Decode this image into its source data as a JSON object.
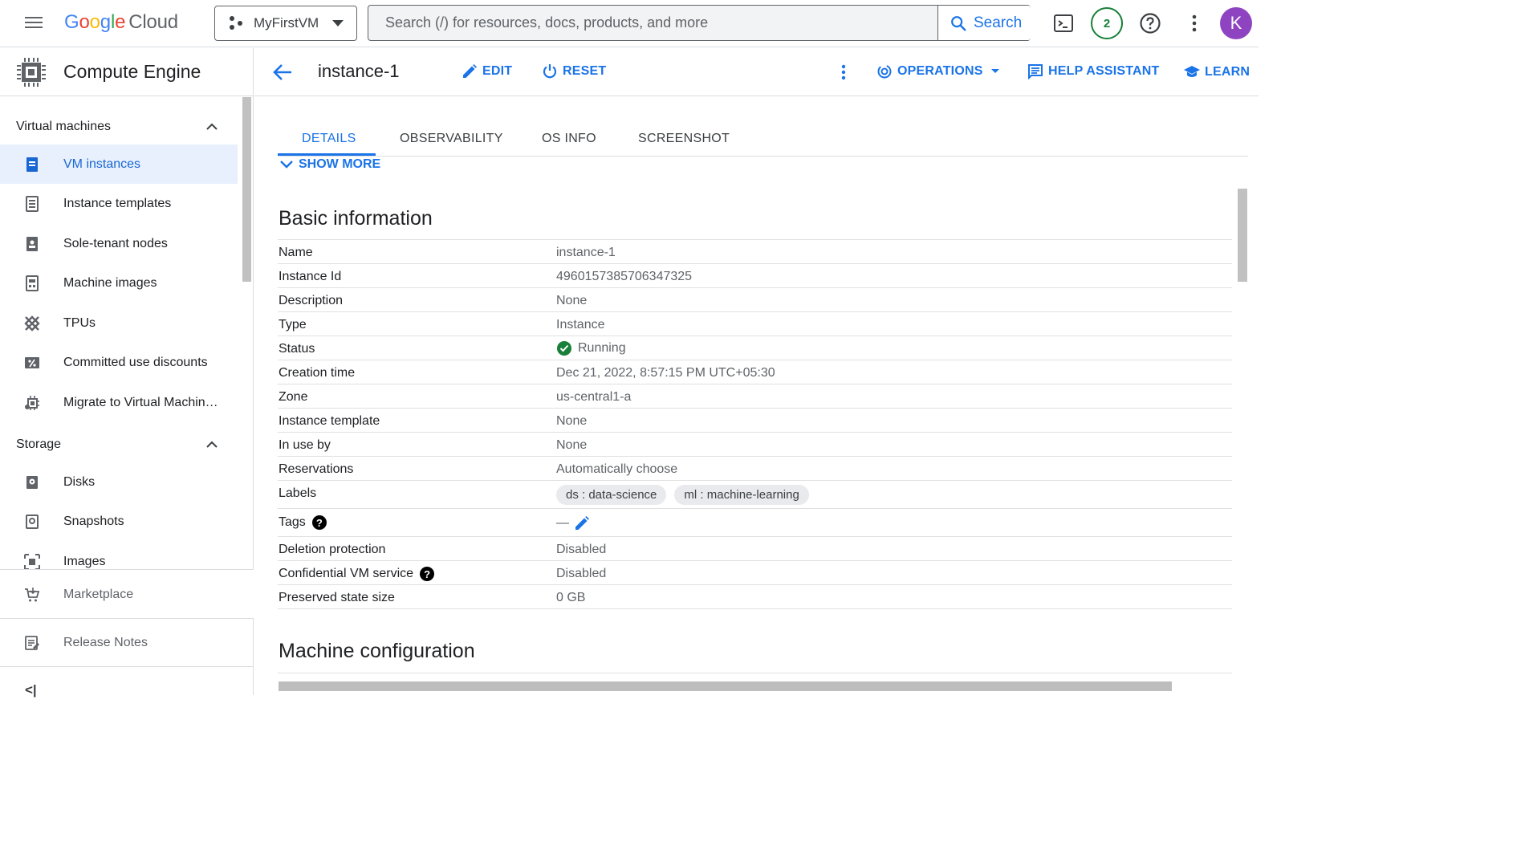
{
  "topbar": {
    "brand_google": [
      "G",
      "o",
      "o",
      "g",
      "l",
      "e"
    ],
    "brand_cloud": "Cloud",
    "project": "MyFirstVM",
    "search_placeholder": "Search (/) for resources, docs, products, and more",
    "search_button": "Search",
    "notification_count": "2",
    "avatar_letter": "K"
  },
  "sidebar": {
    "product_title": "Compute Engine",
    "sections": [
      {
        "label": "Virtual machines"
      },
      {
        "label": "Storage"
      }
    ],
    "vm_items": [
      {
        "label": "VM instances",
        "icon": "vm-instance-icon",
        "active": true
      },
      {
        "label": "Instance templates",
        "icon": "template-icon"
      },
      {
        "label": "Sole-tenant nodes",
        "icon": "node-icon"
      },
      {
        "label": "Machine images",
        "icon": "machine-image-icon"
      },
      {
        "label": "TPUs",
        "icon": "tpu-icon"
      },
      {
        "label": "Committed use discounts",
        "icon": "percent-icon"
      },
      {
        "label": "Migrate to Virtual Machin…",
        "icon": "migrate-icon"
      }
    ],
    "storage_items": [
      {
        "label": "Disks",
        "icon": "disk-icon"
      },
      {
        "label": "Snapshots",
        "icon": "snapshot-icon"
      },
      {
        "label": "Images",
        "icon": "image-icon"
      }
    ],
    "footer_items": [
      {
        "label": "Marketplace",
        "icon": "cart-icon"
      },
      {
        "label": "Release Notes",
        "icon": "notes-icon"
      }
    ],
    "collapse_glyph": "<|"
  },
  "header": {
    "instance_name": "instance-1",
    "edit": "EDIT",
    "reset": "RESET",
    "operations": "OPERATIONS",
    "help_assistant": "HELP ASSISTANT",
    "learn": "LEARN"
  },
  "tabs": [
    "DETAILS",
    "OBSERVABILITY",
    "OS INFO",
    "SCREENSHOT"
  ],
  "show_more": "SHOW MORE",
  "basic_info": {
    "title": "Basic information",
    "rows": [
      {
        "key": "Name",
        "value": "instance-1"
      },
      {
        "key": "Instance Id",
        "value": "4960157385706347325"
      },
      {
        "key": "Description",
        "value": "None"
      },
      {
        "key": "Type",
        "value": "Instance"
      },
      {
        "key": "Status",
        "value": "Running"
      },
      {
        "key": "Creation time",
        "value": "Dec 21, 2022, 8:57:15 PM UTC+05:30"
      },
      {
        "key": "Zone",
        "value": "us-central1-a"
      },
      {
        "key": "Instance template",
        "value": "None"
      },
      {
        "key": "In use by",
        "value": "None"
      },
      {
        "key": "Reservations",
        "value": "Automatically choose"
      },
      {
        "key": "Labels",
        "value": [
          "ds : data-science",
          "ml : machine-learning"
        ]
      },
      {
        "key": "Tags",
        "value": "—"
      },
      {
        "key": "Deletion protection",
        "value": "Disabled"
      },
      {
        "key": "Confidential VM service",
        "value": "Disabled"
      },
      {
        "key": "Preserved state size",
        "value": "0 GB"
      }
    ]
  },
  "machine_config": {
    "title": "Machine configuration"
  },
  "colors": {
    "accent": "#1a73e8",
    "success": "#188038",
    "avatar": "#8e44c0"
  }
}
